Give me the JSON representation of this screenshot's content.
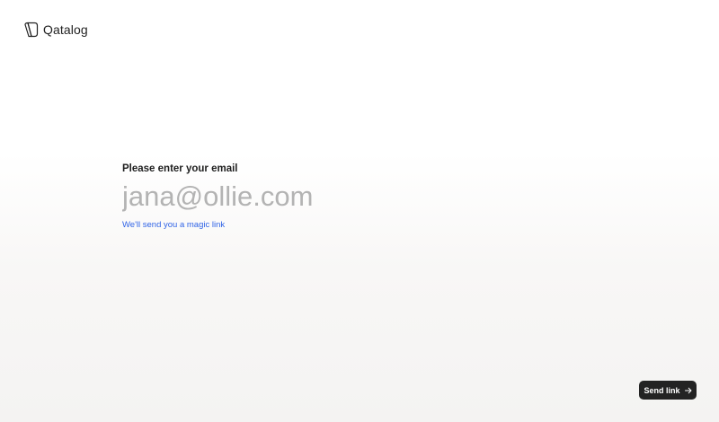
{
  "brand": {
    "name": "Qatalog",
    "logo_icon": "qatalog-logo-icon"
  },
  "form": {
    "prompt": "Please enter your email",
    "email_placeholder": "jana@ollie.com",
    "email_value": "",
    "helper_text": "We'll send you a magic link"
  },
  "actions": {
    "send_label": "Send link",
    "send_icon": "arrow-right-icon"
  },
  "colors": {
    "link": "#2f63e6",
    "button_bg": "#232323",
    "placeholder": "#b3b3b3"
  }
}
